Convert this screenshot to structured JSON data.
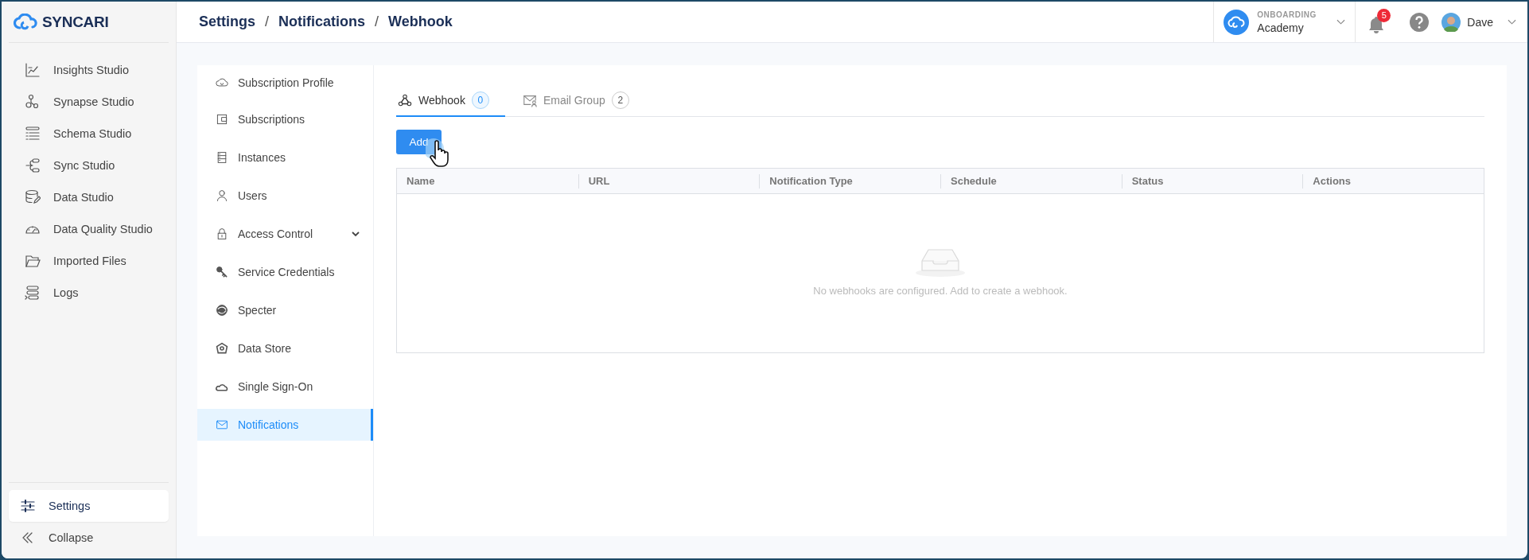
{
  "brand": {
    "name": "SYNCARI"
  },
  "breadcrumb": [
    {
      "kind": "crumb",
      "label": "Settings"
    },
    {
      "kind": "separator",
      "label": "/"
    },
    {
      "kind": "crumb",
      "label": "Notifications"
    },
    {
      "kind": "separator",
      "label": "/"
    },
    {
      "kind": "crumb",
      "label": "Webhook"
    }
  ],
  "workspace": {
    "caption": "ONBOARDING",
    "name": "Academy"
  },
  "notifications": {
    "count": "5"
  },
  "user": {
    "name": "Dave"
  },
  "sidebar": {
    "items": [
      {
        "label": "Insights Studio",
        "selected": false
      },
      {
        "label": "Synapse Studio",
        "selected": false
      },
      {
        "label": "Schema Studio",
        "selected": false
      },
      {
        "label": "Sync Studio",
        "selected": false
      },
      {
        "label": "Data Studio",
        "selected": false
      },
      {
        "label": "Data Quality Studio",
        "selected": false
      },
      {
        "label": "Imported Files",
        "selected": false
      },
      {
        "label": "Logs",
        "selected": false
      }
    ],
    "bottom_items": [
      {
        "label": "Settings",
        "selected": true
      },
      {
        "label": "Collapse",
        "selected": false
      }
    ]
  },
  "settings_menu": {
    "items": [
      {
        "label": "Subscription Profile",
        "selected": false
      },
      {
        "label": "Subscriptions",
        "selected": false
      },
      {
        "label": "Instances",
        "selected": false
      },
      {
        "label": "Users",
        "selected": false
      },
      {
        "label": "Access Control",
        "selected": false,
        "expandable": true
      },
      {
        "label": "Service Credentials",
        "selected": false
      },
      {
        "label": "Specter",
        "selected": false
      },
      {
        "label": "Data Store",
        "selected": false
      },
      {
        "label": "Single Sign-On",
        "selected": false
      },
      {
        "label": "Notifications",
        "selected": true
      }
    ]
  },
  "tabs": [
    {
      "label": "Webhook",
      "count": "0",
      "selected": true
    },
    {
      "label": "Email Group",
      "count": "2",
      "selected": false
    }
  ],
  "add_button": {
    "label": "Add"
  },
  "table": {
    "columns": [
      "Name",
      "URL",
      "Notification Type",
      "Schedule",
      "Status",
      "Actions"
    ],
    "empty_message": "No webhooks are configured. Add to create a webhook."
  }
}
